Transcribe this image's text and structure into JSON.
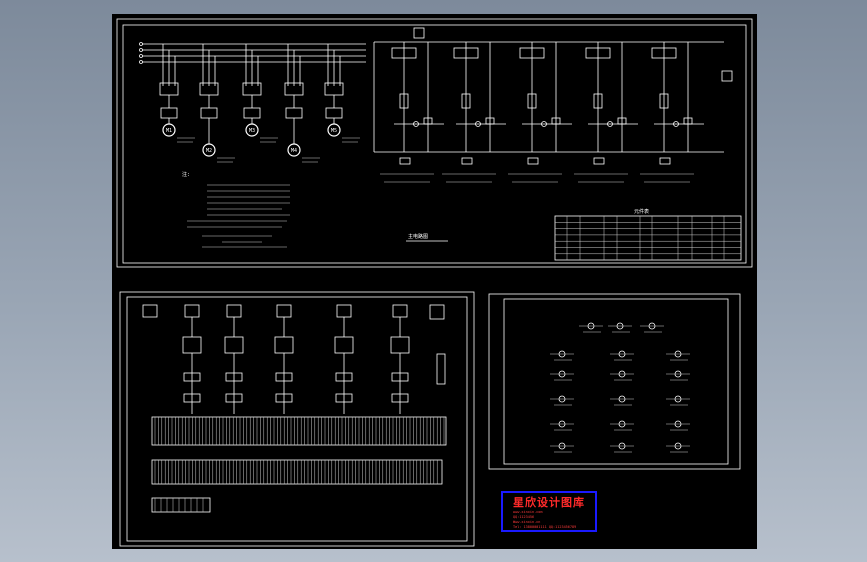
{
  "viewport": {
    "background": "#8793a3"
  },
  "sheet": {
    "background": "#000000",
    "line_color": "#ffffff"
  },
  "top_panel": {
    "title_label": "主电路图",
    "control_caption": "控制电路图",
    "table_title": "元件表",
    "table_headers": [
      "序号",
      "代号",
      "名称",
      "型号规格",
      "数量",
      "备注"
    ]
  },
  "motors": [
    {
      "label": "M1"
    },
    {
      "label": "M2"
    },
    {
      "label": "M3"
    },
    {
      "label": "M4"
    },
    {
      "label": "M5"
    }
  ],
  "stamp": {
    "title": "星欣设计图库",
    "border_color": "#1a1aff",
    "text_color": "#ff2a2a",
    "line1": "www.xinxin.com",
    "line2": "QQ:1123456",
    "line3": "Www.xinxin.cn",
    "line4": "Tel: 13800001111  QQ:1123456789"
  }
}
